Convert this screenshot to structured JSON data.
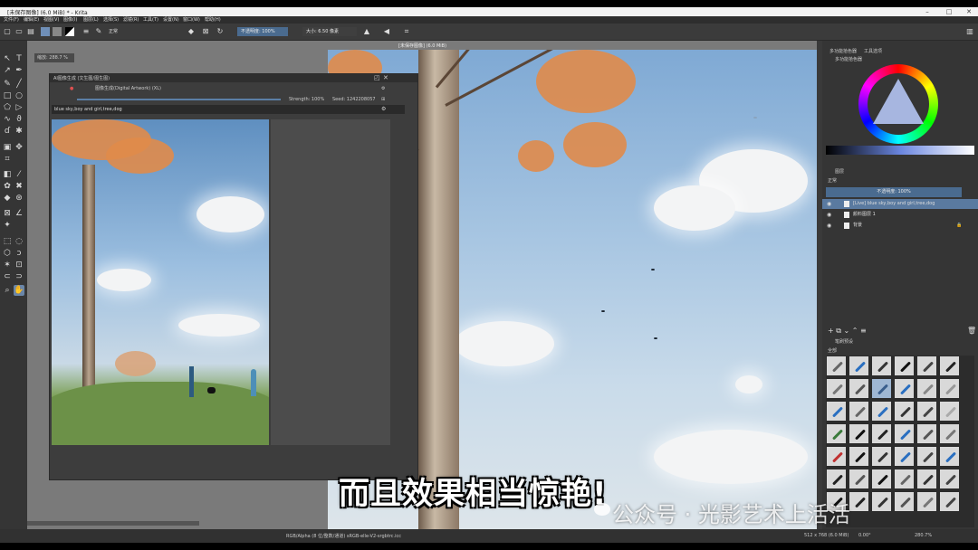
{
  "window": {
    "title": "[未保存图像] (6.0 MiB) * - Krita",
    "controls": [
      "–",
      "□",
      "✕"
    ]
  },
  "menu": [
    "文件(F)",
    "编辑(E)",
    "视图(V)",
    "图像(I)",
    "图层(L)",
    "选择(S)",
    "滤镜(R)",
    "工具(T)",
    "设置(N)",
    "窗口(W)",
    "帮助(H)"
  ],
  "toolbar": {
    "blend_mode": "正常",
    "opacity": "不透明度: 100%",
    "size": "大小: 6.50 像素"
  },
  "canvas": {
    "doc_title": "[未保存图像] (6.0 MiB)"
  },
  "ai_dialog": {
    "title": "AI图像生成 (文生图/图生图)",
    "workspace": "图像生成(Digital Artwork) (XL)",
    "strength": "Strength: 100%",
    "seed": "Seed: 1242208057",
    "prompt": "blue sky,boy and girl,tree,dog",
    "tooltip": "缩放: 288.7 %"
  },
  "panels": {
    "color_tab_1": "多功能拾色器",
    "color_tab_2": "工具选项",
    "color_sub": "多功能拾色器",
    "layers_title": "图层",
    "layers_mode": "正常",
    "layer_opacity": "不透明度: 100%",
    "layers": [
      {
        "name": "[Live] blue sky,boy and girl,tree,dog",
        "selected": true
      },
      {
        "name": "颜料图层 1",
        "selected": false
      },
      {
        "name": "背景",
        "selected": false
      }
    ],
    "brush_title": "笔刷预设",
    "brush_tag": "全部"
  },
  "status": {
    "color_space": "RGB/Alpha (8 位/整数/通道)  sRGB-elle-V2-srgbtrc.icc",
    "dimensions": "512 x 768 (6.0 MiB)",
    "rotation": "0.00°",
    "zoom": "280.7%"
  },
  "subtitle": "而且效果相当惊艳!",
  "watermark": "公众号 · 光影艺术上活活",
  "colors": {
    "accent": "#4a6b8f",
    "selection": "#5a7aa0",
    "panel_bg": "#353535"
  }
}
